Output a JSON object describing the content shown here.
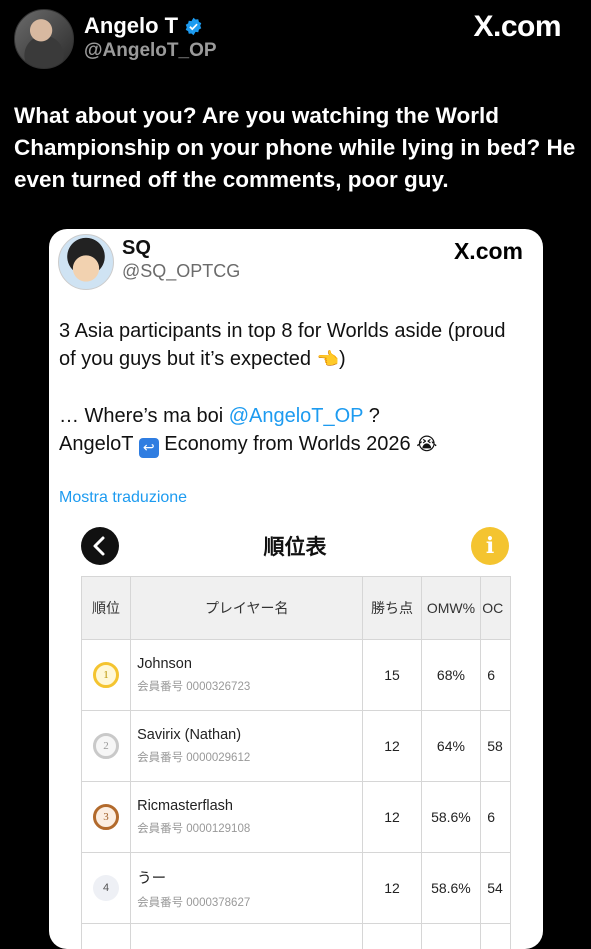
{
  "outer": {
    "name": "Angelo T",
    "handle": "@AngeloT_OP",
    "logo": "X.com",
    "text": "What about you? Are you watching the World Championship on your phone while lying in bed? He even turned off the comments, poor guy."
  },
  "card": {
    "name": "SQ",
    "handle": "@SQ_OPTCG",
    "logo": "X.com",
    "line1": "3 Asia participants in top 8 for Worlds aside (proud",
    "line2a": "of you guys but it’s expected ",
    "line2b": ")",
    "line3a": "… Where’s ma boi ",
    "line3_mention": "@AngeloT_OP",
    "line3b": " ?",
    "line4a": "AngeloT ",
    "line4b": " Economy from Worlds 2026 ",
    "translate": "Mostra traduzione"
  },
  "standings": {
    "title": "順位表",
    "headers": [
      "順位",
      "プレイヤー名",
      "勝ち点",
      "OMW%",
      "OC"
    ],
    "rows": [
      {
        "rank": "1",
        "name": "Johnson",
        "id": "会員番号 0000326723",
        "points": "15",
        "omw": "68%",
        "extra": "6"
      },
      {
        "rank": "2",
        "name": "Savirix (Nathan)",
        "id": "会員番号 0000029612",
        "points": "12",
        "omw": "64%",
        "extra": "58"
      },
      {
        "rank": "3",
        "name": "Ricmasterflash",
        "id": "会員番号 0000129108",
        "points": "12",
        "omw": "58.6%",
        "extra": "6"
      },
      {
        "rank": "4",
        "name": "うー",
        "id": "会員番号 0000378627",
        "points": "12",
        "omw": "58.6%",
        "extra": "54"
      }
    ]
  },
  "colors": {
    "accent": "#1d9bf0",
    "gold": "#f4c430",
    "silver": "#c9c9c9",
    "bronze": "#b26a2c"
  }
}
